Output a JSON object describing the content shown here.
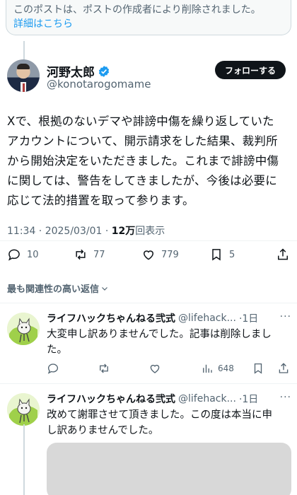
{
  "deleted_notice": {
    "text": "このポストは、ポストの作成者により削除されました。",
    "link": "詳細はこちら"
  },
  "main_post": {
    "display_name": "河野太郎",
    "handle": "@konotarogomame",
    "follow_label": "フォローする",
    "text_lines": [
      "Xで、根拠のないデマや誹謗中傷を繰り返していた",
      "アカウントについて、開示請求をした結果、裁判所",
      "から開始決定をいただきました。これまで誹謗中傷",
      "に関しては、警告をしてきましたが、今後は必要に",
      "応じて法的措置を取って参ります。"
    ],
    "timestamp": "11:34 · 2025/03/01 · ",
    "views_count": "12万",
    "views_label": "回表示",
    "reply_count": "10",
    "repost_count": "77",
    "like_count": "779",
    "bookmark_count": "5"
  },
  "sort_label": "最も関連性の高い返信",
  "replies": [
    {
      "name": "ライフハックちゃんねる弐式",
      "handle": "@lifehack...",
      "time": "·1日",
      "more": "···",
      "text_lines": [
        "大変申し訳ありませんでした。記事は削除しまし",
        "た。"
      ],
      "views": "648"
    },
    {
      "name": "ライフハックちゃんねる弐式",
      "handle": "@lifehack...",
      "time": "·1日",
      "more": "···",
      "text_lines": [
        "改めて謝罪させて頂きました。この度は本当に申",
        "し訳ありませんでした。"
      ]
    }
  ],
  "colors": {
    "accent": "#1d9bf0",
    "text": "#0f1419",
    "muted": "#536471",
    "border": "#eff3f4"
  }
}
